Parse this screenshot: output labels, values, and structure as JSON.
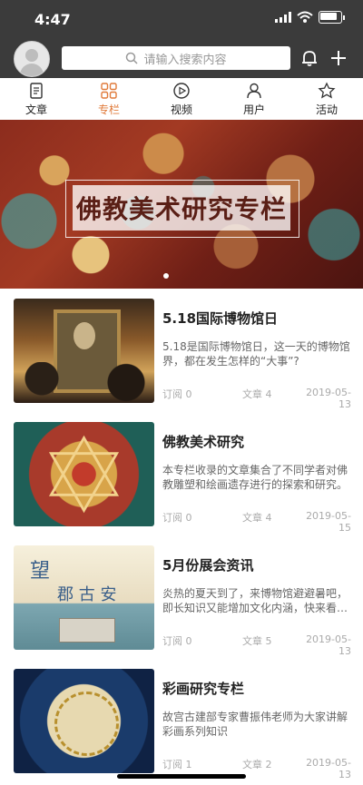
{
  "status": {
    "time": "4:47"
  },
  "header": {
    "search_placeholder": "请输入搜索内容",
    "icons": {
      "search": "search-icon",
      "bell": "bell-icon",
      "plus": "plus-icon",
      "avatar": "avatar-icon"
    }
  },
  "tabs": [
    {
      "label": "文章",
      "icon": "document-icon",
      "active": false
    },
    {
      "label": "专栏",
      "icon": "grid-icon",
      "active": true
    },
    {
      "label": "视频",
      "icon": "play-icon",
      "active": false
    },
    {
      "label": "用户",
      "icon": "user-icon",
      "active": false
    },
    {
      "label": "活动",
      "icon": "star-icon",
      "active": false
    }
  ],
  "banner": {
    "title": "佛教美术研究专栏"
  },
  "items": [
    {
      "title": "5.18国际博物馆日",
      "desc": "5.18是国际博物馆日，这一天的博物馆界，都在发生怎样的“大事”?",
      "subscribe": "订阅 0",
      "articles": "文章 4",
      "date": "2019-05-13"
    },
    {
      "title": "佛教美术研究",
      "desc": "本专栏收录的文章集合了不同学者对佛教雕塑和绘画遗存进行的探索和研究。",
      "subscribe": "订阅 0",
      "articles": "文章 4",
      "date": "2019-05-15"
    },
    {
      "title": "5月份展会资讯",
      "desc": "炎热的夏天到了，来博物馆避避暑吧，即长知识又能增加文化内涵，快来看…",
      "subscribe": "订阅 0",
      "articles": "文章 5",
      "date": "2019-05-13"
    },
    {
      "title": "彩画研究专栏",
      "desc": "故宫古建部专家曹振伟老师为大家讲解彩画系列知识",
      "subscribe": "订阅 1",
      "articles": "文章 2",
      "date": "2019-05-13"
    }
  ],
  "thumb_texts": {
    "item3_line1": "望",
    "item3_line2": "郡 古 安"
  },
  "colors": {
    "accent": "#e07a3a",
    "header_bg": "#3b3b3b"
  }
}
